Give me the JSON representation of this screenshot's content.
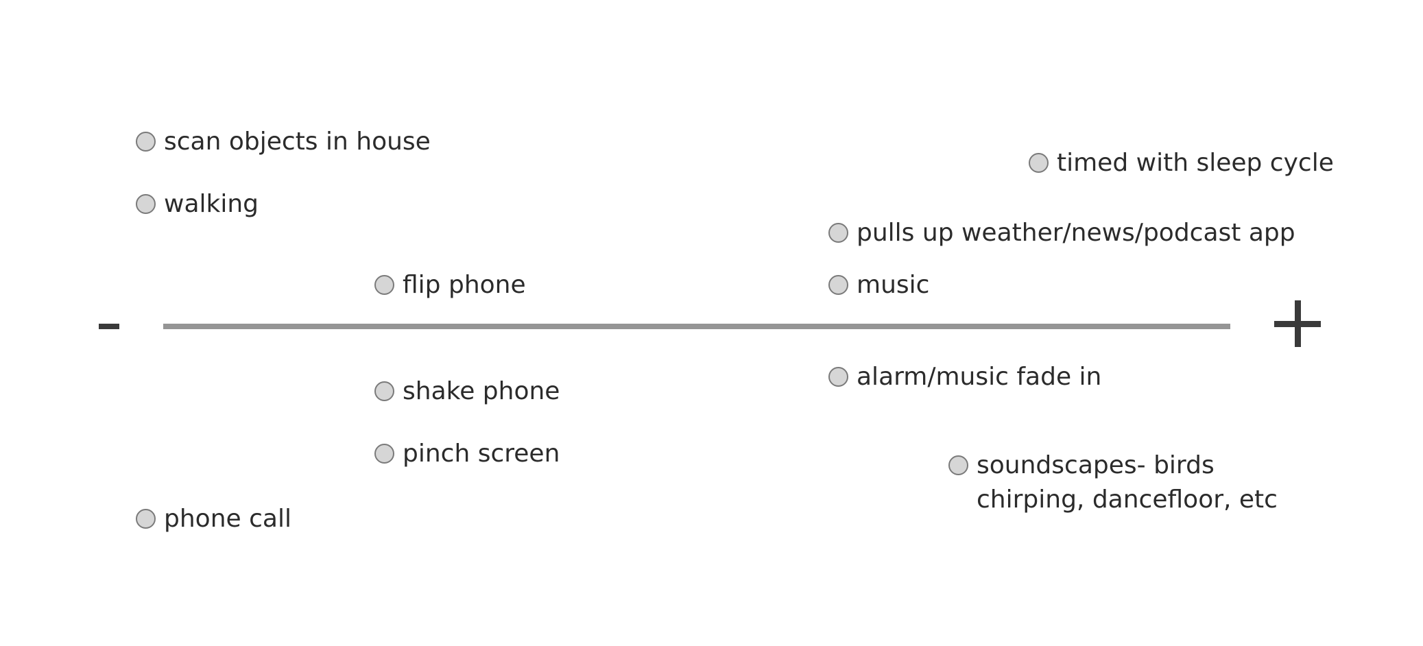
{
  "axis": {
    "minus_symbol": "-",
    "plus_symbol": "+"
  },
  "items": [
    {
      "label": "scan objects in house"
    },
    {
      "label": "walking"
    },
    {
      "label": "flip phone"
    },
    {
      "label": "shake phone"
    },
    {
      "label": "pinch screen"
    },
    {
      "label": "phone call"
    },
    {
      "label": "timed with sleep cycle"
    },
    {
      "label": "pulls up weather/news/podcast app"
    },
    {
      "label": "music"
    },
    {
      "label": "alarm/music fade in"
    },
    {
      "label_line1": "soundscapes- birds",
      "label_line2": "chirping, dancefloor, etc"
    }
  ]
}
